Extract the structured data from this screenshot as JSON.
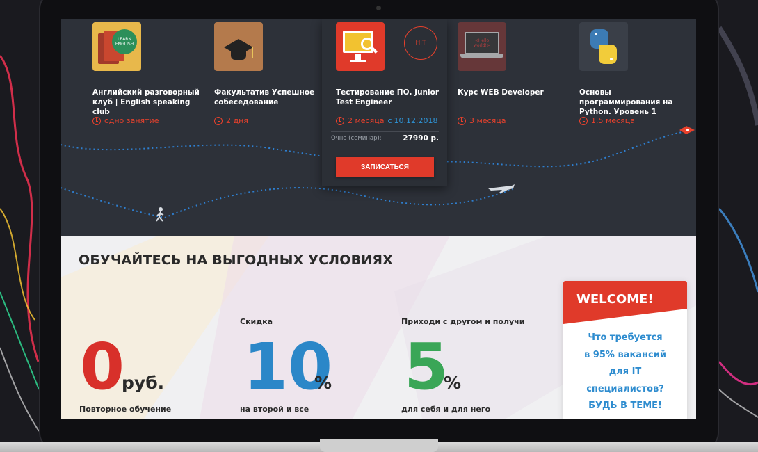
{
  "courses": [
    {
      "title": "Английский разговорный клуб | English speaking club",
      "duration": "одно занятие",
      "icon": "english-club-book-icon"
    },
    {
      "title": "Факультатив Успешное собеседование",
      "duration": "2 дня",
      "icon": "graduation-cap-icon"
    },
    {
      "title": "Тестирование ПО. Junior Test Engineer",
      "duration": "2 месяца",
      "date_prefix": "с",
      "date": "10.12.2018",
      "icon": "software-testing-monitor-icon"
    },
    {
      "title": "Курс WEB Developer",
      "duration": "3 месяца",
      "icon": "laptop-hello-world-icon"
    },
    {
      "title": "Основы программирования на Python. Уровень 1",
      "duration": "1,5 месяца",
      "icon": "python-logo-icon"
    }
  ],
  "hit_badge": "HIT",
  "price": {
    "label": "Очно (семинар):",
    "value": "27990 р."
  },
  "enroll_label": "ЗАПИСАТЬСЯ",
  "english_book_text": "LEARN ENGLISH",
  "laptop_screen_text": "<Hello world!>",
  "benefits": {
    "title": "ОБУЧАЙТЕСЬ НА ВЫГОДНЫХ УСЛОВИЯХ",
    "items": [
      {
        "top_label": "",
        "number": "0",
        "unit": "руб.",
        "caption": "Повторное обучение",
        "color": "#d8302a"
      },
      {
        "top_label": "Скидка",
        "number": "10",
        "unit": "%",
        "caption": "на второй и все",
        "color": "#2b87c8"
      },
      {
        "top_label": "Приходи с другом и получи",
        "number": "5",
        "unit": "%",
        "caption": "для себя и для него",
        "color": "#3aa657"
      }
    ]
  },
  "welcome": {
    "title": "WELCOME!",
    "text": "Что требуется\nв 95% вакансий\nдля IT\nспециалистов?\nБУДЬ В ТЕМЕ!"
  },
  "colors": {
    "accent_red": "#e03a2a",
    "blue": "#2e95d8",
    "dark_bg": "#2d3139"
  }
}
